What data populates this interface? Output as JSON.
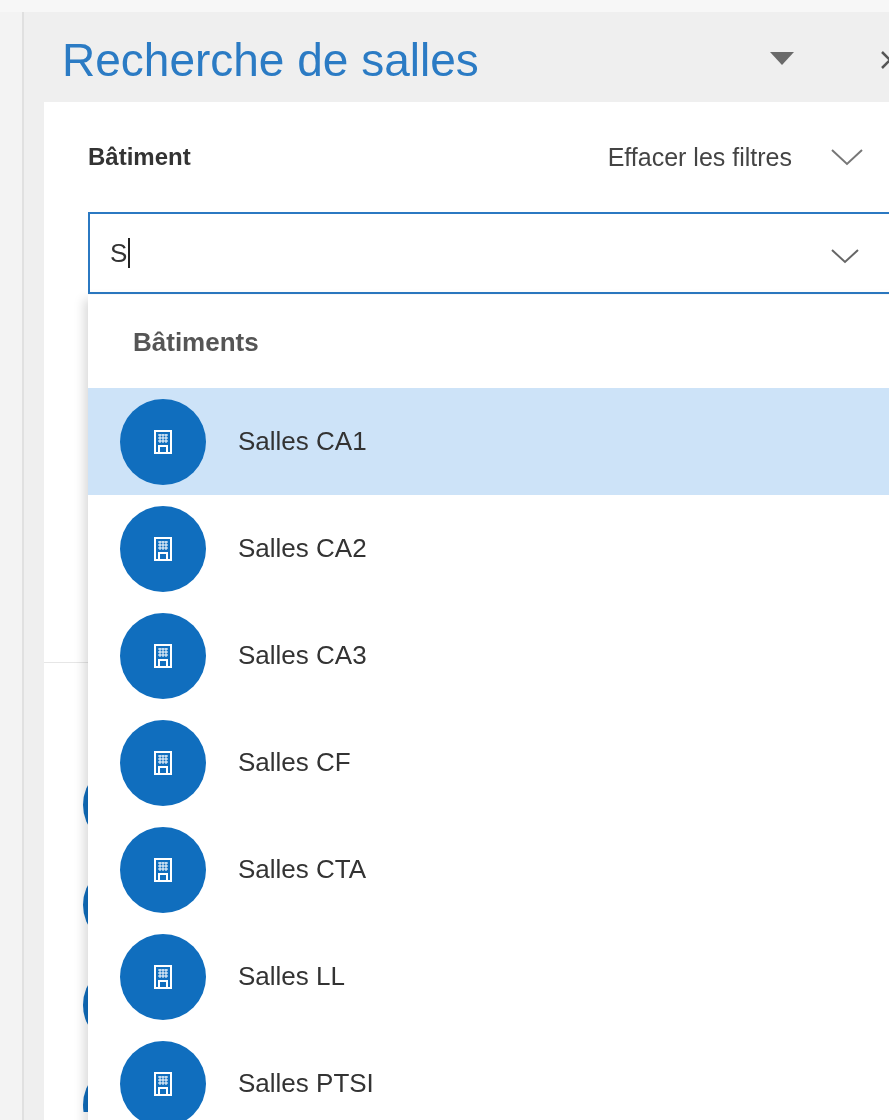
{
  "panel": {
    "title": "Recherche de salles"
  },
  "filter": {
    "label": "Bâtiment",
    "clear_link": "Effacer les filtres",
    "value": "S"
  },
  "dropdown": {
    "header": "Bâtiments",
    "items": [
      {
        "label": "Salles CA1",
        "selected": true
      },
      {
        "label": "Salles CA2",
        "selected": false
      },
      {
        "label": "Salles CA3",
        "selected": false
      },
      {
        "label": "Salles CF",
        "selected": false
      },
      {
        "label": "Salles CTA",
        "selected": false
      },
      {
        "label": "Salles LL",
        "selected": false
      },
      {
        "label": "Salles PTSI",
        "selected": false
      }
    ]
  }
}
